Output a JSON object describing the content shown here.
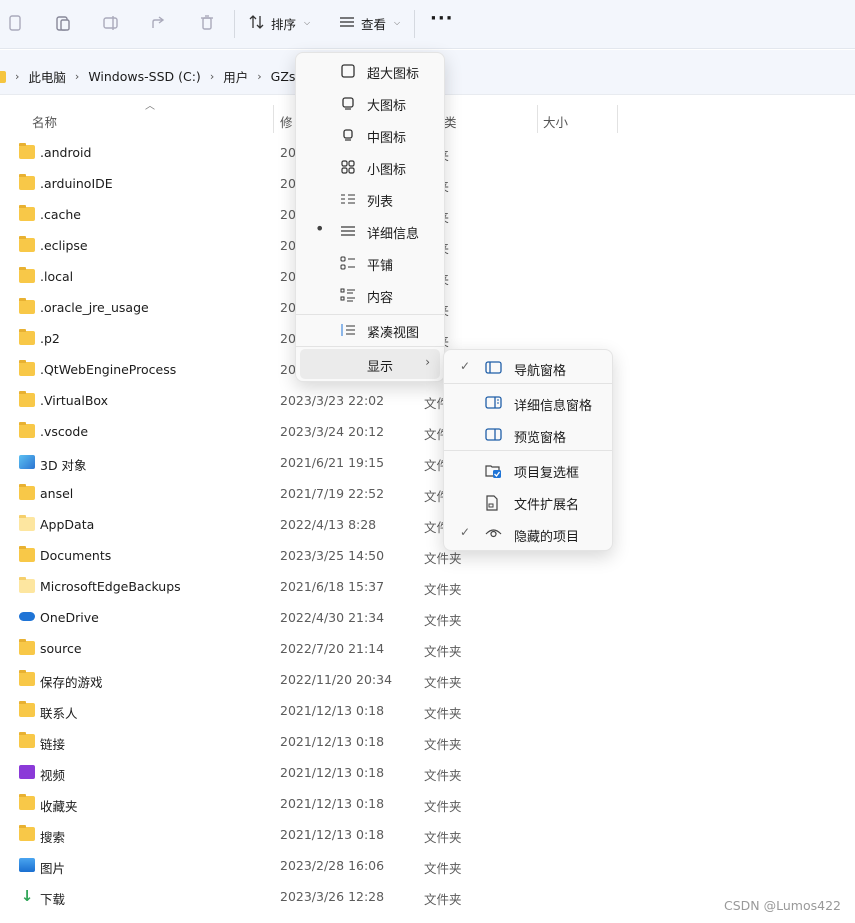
{
  "toolbar": {
    "sort_label": "排序",
    "view_label": "查看",
    "more_label": "···",
    "icons": [
      "copy-icon",
      "paste-icon",
      "rename-icon",
      "share-icon",
      "delete-icon",
      "sort-icon",
      "view-icon"
    ]
  },
  "breadcrumb": {
    "items": [
      "此电脑",
      "Windows-SSD (C:)",
      "用户",
      "GZsh"
    ]
  },
  "columns": {
    "name": "名称",
    "modified": "修",
    "type": "",
    "size": "大小"
  },
  "files": [
    {
      "name": ".android",
      "date": "20",
      "type": "件夹",
      "icon": "folder"
    },
    {
      "name": ".arduinoIDE",
      "date": "20",
      "type": "件夹",
      "icon": "folder"
    },
    {
      "name": ".cache",
      "date": "20",
      "type": "件夹",
      "icon": "folder"
    },
    {
      "name": ".eclipse",
      "date": "20",
      "type": "件夹",
      "icon": "folder"
    },
    {
      "name": ".local",
      "date": "20",
      "type": "件夹",
      "icon": "folder"
    },
    {
      "name": ".oracle_jre_usage",
      "date": "20",
      "type": "件夹",
      "icon": "folder"
    },
    {
      "name": ".p2",
      "date": "20",
      "type": "件夹",
      "icon": "folder"
    },
    {
      "name": ".QtWebEngineProcess",
      "date": "20",
      "type": "",
      "icon": "folder"
    },
    {
      "name": ".VirtualBox",
      "date": "2023/3/23 22:02",
      "type": "文件",
      "icon": "folder"
    },
    {
      "name": ".vscode",
      "date": "2023/3/24 20:12",
      "type": "文件",
      "icon": "folder"
    },
    {
      "name": "3D 对象",
      "date": "2021/6/21 19:15",
      "type": "文件",
      "icon": "cube"
    },
    {
      "name": "ansel",
      "date": "2021/7/19 22:52",
      "type": "文件",
      "icon": "folder"
    },
    {
      "name": "AppData",
      "date": "2022/4/13 8:28",
      "type": "文件",
      "icon": "folder-light"
    },
    {
      "name": "Documents",
      "date": "2023/3/25 14:50",
      "type": "文件夹",
      "icon": "folder"
    },
    {
      "name": "MicrosoftEdgeBackups",
      "date": "2021/6/18 15:37",
      "type": "文件夹",
      "icon": "folder-light"
    },
    {
      "name": "OneDrive",
      "date": "2022/4/30 21:34",
      "type": "文件夹",
      "icon": "cloud"
    },
    {
      "name": "source",
      "date": "2022/7/20 21:14",
      "type": "文件夹",
      "icon": "folder"
    },
    {
      "name": "保存的游戏",
      "date": "2022/11/20 20:34",
      "type": "文件夹",
      "icon": "folder"
    },
    {
      "name": "联系人",
      "date": "2021/12/13 0:18",
      "type": "文件夹",
      "icon": "folder"
    },
    {
      "name": "链接",
      "date": "2021/12/13 0:18",
      "type": "文件夹",
      "icon": "folder"
    },
    {
      "name": "视频",
      "date": "2021/12/13 0:18",
      "type": "文件夹",
      "icon": "video"
    },
    {
      "name": "收藏夹",
      "date": "2021/12/13 0:18",
      "type": "文件夹",
      "icon": "folder"
    },
    {
      "name": "搜索",
      "date": "2021/12/13 0:18",
      "type": "文件夹",
      "icon": "folder"
    },
    {
      "name": "图片",
      "date": "2023/2/28 16:06",
      "type": "文件夹",
      "icon": "picture"
    },
    {
      "name": "下载",
      "date": "2023/3/26 12:28",
      "type": "文件夹",
      "icon": "download"
    }
  ],
  "view_menu": {
    "items": [
      {
        "label": "超大图标",
        "icon": "extra-large-icons-icon"
      },
      {
        "label": "大图标",
        "icon": "large-icons-icon"
      },
      {
        "label": "中图标",
        "icon": "medium-icons-icon"
      },
      {
        "label": "小图标",
        "icon": "small-icons-icon"
      },
      {
        "label": "列表",
        "icon": "list-icon"
      },
      {
        "label": "详细信息",
        "icon": "details-icon",
        "selected": true
      },
      {
        "label": "平铺",
        "icon": "tiles-icon"
      },
      {
        "label": "内容",
        "icon": "content-icon"
      }
    ],
    "compact_label": "紧凑视图",
    "show_label": "显示"
  },
  "show_menu": {
    "items": [
      {
        "label": "导航窗格",
        "checked": true,
        "icon": "navigation-pane-icon"
      },
      {
        "label": "详细信息窗格",
        "checked": false,
        "icon": "details-pane-icon"
      },
      {
        "label": "预览窗格",
        "checked": false,
        "icon": "preview-pane-icon"
      },
      {
        "label": "项目复选框",
        "checked": false,
        "icon": "item-checkbox-icon"
      },
      {
        "label": "文件扩展名",
        "checked": false,
        "icon": "file-extension-icon"
      },
      {
        "label": "隐藏的项目",
        "checked": true,
        "icon": "hidden-items-icon"
      }
    ]
  },
  "watermark": "CSDN @Lumos422",
  "colors": {
    "toolbar_bg": "#f3f6fc",
    "folder": "#f8c848",
    "accent": "#1f74d6"
  }
}
